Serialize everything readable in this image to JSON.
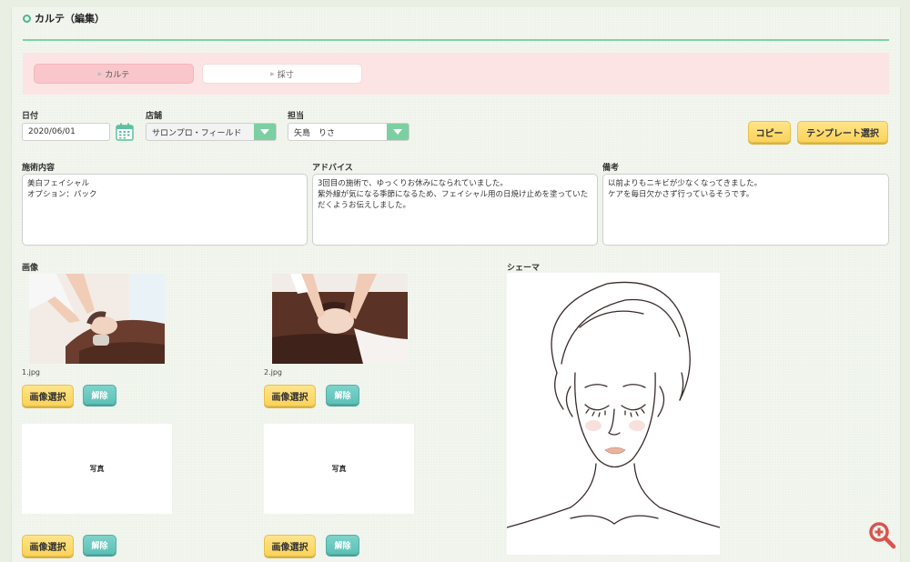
{
  "page": {
    "title": "カルテ（編集）",
    "accent_color": "#49b98c"
  },
  "tabs": [
    {
      "label": "カルテ",
      "active": true
    },
    {
      "label": "採寸",
      "active": false
    }
  ],
  "form": {
    "date_label": "日付",
    "date_value": "2020/06/01",
    "shop_label": "店舗",
    "shop_value": "サロンプロ・フィールド",
    "staff_label": "担当",
    "staff_value": "矢島　りさ",
    "copy_button": "コピー",
    "template_button": "テンプレート選択"
  },
  "notes": {
    "treatment_label": "施術内容",
    "treatment_text": "美白フェイシャル\nオプション：パック",
    "advice_label": "アドバイス",
    "advice_text": "3回目の施術で、ゆっくりお休みになられていました。\n紫外線が気になる季節になるため、フェイシャル用の日焼け止めを塗っていただくようお伝えしました。",
    "remarks_label": "備考",
    "remarks_text": "以前よりもニキビが少なくなってきました。\nケアを毎日欠かさず行っているそうです。"
  },
  "images": {
    "section_label": "画像",
    "slots": [
      {
        "filename": "1.jpg",
        "select_label": "画像選択",
        "clear_label": "解除"
      },
      {
        "filename": "2.jpg",
        "select_label": "画像選択",
        "clear_label": "解除"
      },
      {
        "placeholder": "写真",
        "select_label": "画像選択",
        "clear_label": "解除"
      },
      {
        "placeholder": "写真",
        "select_label": "画像選択",
        "clear_label": "解除"
      }
    ]
  },
  "schema": {
    "label": "シェーマ"
  },
  "icons": {
    "calendar": "calendar-icon",
    "zoom": "zoom-in-icon"
  }
}
